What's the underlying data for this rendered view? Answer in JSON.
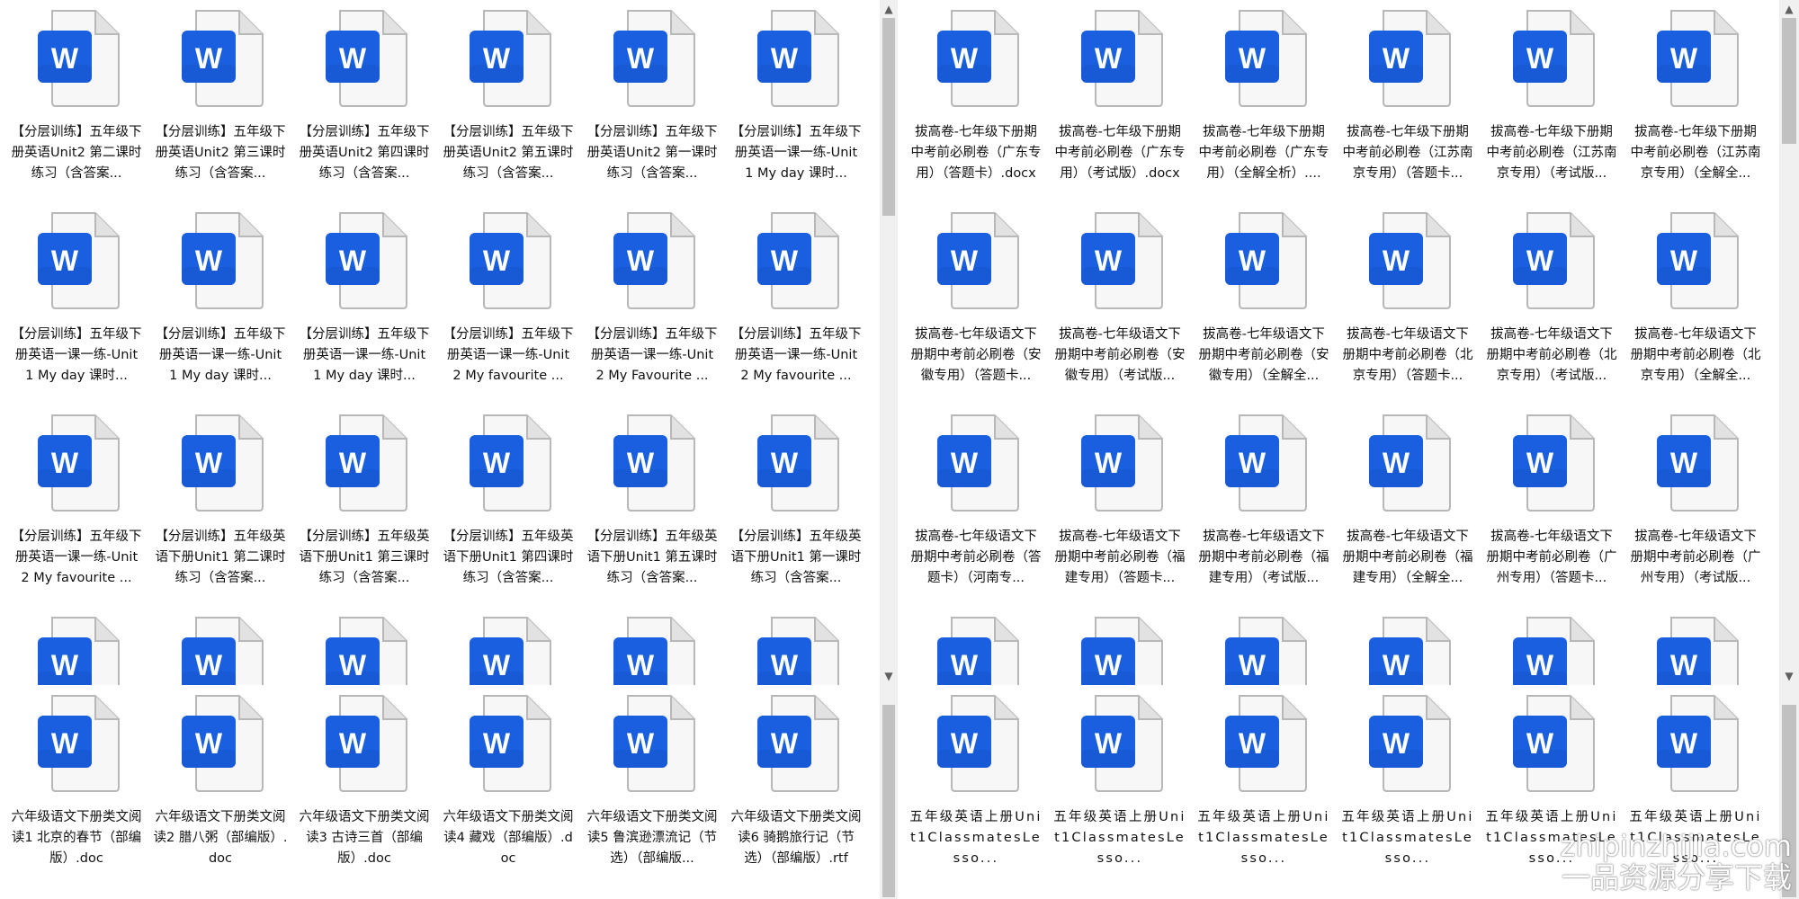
{
  "icon_colors": {
    "page": "#f7f7f7",
    "fold": "#e2e2e2",
    "outline": "#b8b8b8",
    "badge": "#1a5fe0",
    "badge_dark": "#1750c4",
    "letter": "#ffffff"
  },
  "icon_letter": "W",
  "icon_name": "word-document-icon",
  "scroll_up": "▲",
  "scroll_down": "▼",
  "panes": [
    {
      "rows": [
        [
          "【分层训练】五年级下册英语Unit2 第二课时练习（含答案...",
          "【分层训练】五年级下册英语Unit2 第三课时练习（含答案...",
          "【分层训练】五年级下册英语Unit2 第四课时练习（含答案...",
          "【分层训练】五年级下册英语Unit2 第五课时练习（含答案...",
          "【分层训练】五年级下册英语Unit2 第一课时练习（含答案...",
          "【分层训练】五年级下册英语一课一练-Unit 1 My day 课时..."
        ],
        [
          "【分层训练】五年级下册英语一课一练-Unit 1 My day 课时...",
          "【分层训练】五年级下册英语一课一练-Unit 1 My day 课时...",
          "【分层训练】五年级下册英语一课一练-Unit 1 My day 课时...",
          "【分层训练】五年级下册英语一课一练-Unit 2 My favourite ...",
          "【分层训练】五年级下册英语一课一练-Unit 2 My Favourite ...",
          "【分层训练】五年级下册英语一课一练-Unit 2 My favourite ..."
        ],
        [
          "【分层训练】五年级下册英语一课一练-Unit 2 My favourite ...",
          "【分层训练】五年级英语下册Unit1 第二课时练习（含答案...",
          "【分层训练】五年级英语下册Unit1 第三课时练习（含答案...",
          "【分层训练】五年级英语下册Unit1 第四课时练习（含答案...",
          "【分层训练】五年级英语下册Unit1 第五课时练习（含答案...",
          "【分层训练】五年级英语下册Unit1 第一课时练习（含答案..."
        ]
      ]
    },
    {
      "rows": [
        [
          "拔高卷-七年级下册期中考前必刷卷（广东专用）（答题卡）.docx",
          "拔高卷-七年级下册期中考前必刷卷（广东专用）（考试版）.docx",
          "拔高卷-七年级下册期中考前必刷卷（广东专用）（全解全析）....",
          "拔高卷-七年级下册期中考前必刷卷（江苏南京专用）（答题卡...",
          "拔高卷-七年级下册期中考前必刷卷（江苏南京专用）（考试版...",
          "拔高卷-七年级下册期中考前必刷卷（江苏南京专用）（全解全..."
        ],
        [
          "拔高卷-七年级语文下册期中考前必刷卷（安徽专用）（答题卡...",
          "拔高卷-七年级语文下册期中考前必刷卷（安徽专用）（考试版...",
          "拔高卷-七年级语文下册期中考前必刷卷（安徽专用）（全解全...",
          "拔高卷-七年级语文下册期中考前必刷卷（北京专用）（答题卡...",
          "拔高卷-七年级语文下册期中考前必刷卷（北京专用）（考试版...",
          "拔高卷-七年级语文下册期中考前必刷卷（北京专用）（全解全..."
        ],
        [
          "拔高卷-七年级语文下册期中考前必刷卷（答题卡）（河南专...",
          "拔高卷-七年级语文下册期中考前必刷卷（福建专用）（答题卡...",
          "拔高卷-七年级语文下册期中考前必刷卷（福建专用）（考试版...",
          "拔高卷-七年级语文下册期中考前必刷卷（福建专用）（全解全...",
          "拔高卷-七年级语文下册期中考前必刷卷（广州专用）（答题卡...",
          "拔高卷-七年级语文下册期中考前必刷卷（广州专用）（考试版..."
        ]
      ]
    },
    {
      "rows": [
        [
          "六年级语文下册类文阅读1 北京的春节（部编版）.doc",
          "六年级语文下册类文阅读2 腊八粥（部编版）.doc",
          "六年级语文下册类文阅读3 古诗三首（部编版）.doc",
          "六年级语文下册类文阅读4 藏戏（部编版）.doc",
          "六年级语文下册类文阅读5 鲁滨逊漂流记（节选）（部编版...",
          "六年级语文下册类文阅读6 骑鹅旅行记（节选）（部编版）.rtf"
        ]
      ]
    },
    {
      "rows": [
        [
          "五年级英语上册Unit1ClassmatesLesso...",
          "五年级英语上册Unit1ClassmatesLesso...",
          "五年级英语上册Unit1ClassmatesLesso...",
          "五年级英语上册Unit1ClassmatesLesso...",
          "五年级英语上册Unit1ClassmatesLesso...",
          "五年级英语上册Unit1ClassmatesLesso..."
        ]
      ]
    }
  ],
  "watermark": {
    "url": "zhipinzhijia.com",
    "text": "一品资源分享下载"
  }
}
